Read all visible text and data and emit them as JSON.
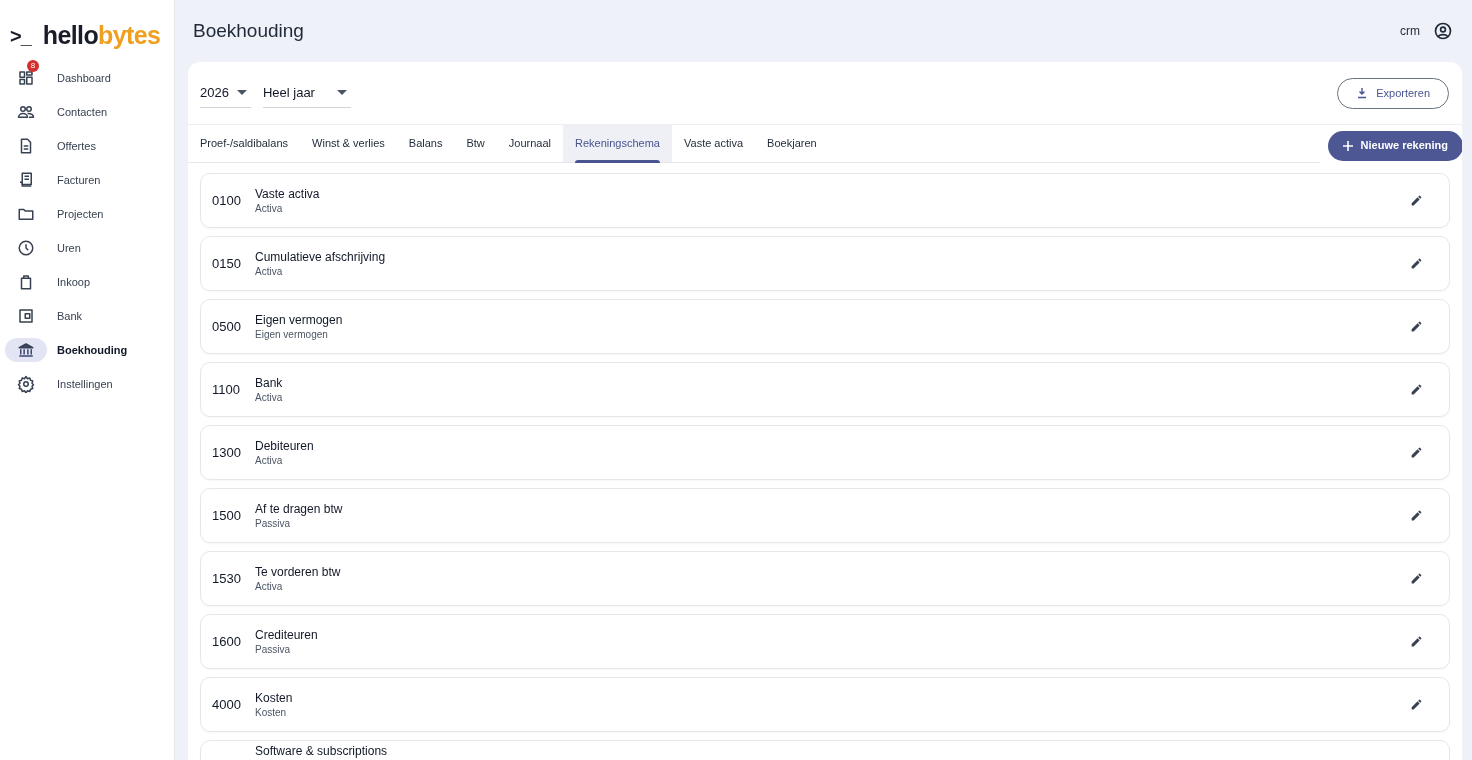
{
  "logo": {
    "prompt": ">_",
    "name_dark": "hello",
    "name_accent": "bytes"
  },
  "sidebar": {
    "items": [
      {
        "label": "Dashboard",
        "selected": false,
        "badge": "8"
      },
      {
        "label": "Contacten",
        "selected": false
      },
      {
        "label": "Offertes",
        "selected": false
      },
      {
        "label": "Facturen",
        "selected": false
      },
      {
        "label": "Projecten",
        "selected": false
      },
      {
        "label": "Uren",
        "selected": false
      },
      {
        "label": "Inkoop",
        "selected": false
      },
      {
        "label": "Bank",
        "selected": false
      },
      {
        "label": "Boekhouding",
        "selected": true
      },
      {
        "label": "Instellingen",
        "selected": false
      }
    ]
  },
  "header": {
    "title": "Boekhouding",
    "user": "crm"
  },
  "filters": {
    "year": "2026",
    "period": "Heel jaar"
  },
  "export_button": "Exporteren",
  "tabs": [
    {
      "label": "Proef-/saldibalans",
      "selected": false
    },
    {
      "label": "Winst & verlies",
      "selected": false
    },
    {
      "label": "Balans",
      "selected": false
    },
    {
      "label": "Btw",
      "selected": false
    },
    {
      "label": "Journaal",
      "selected": false
    },
    {
      "label": "Rekeningschema",
      "selected": true
    },
    {
      "label": "Vaste activa",
      "selected": false
    },
    {
      "label": "Boekjaren",
      "selected": false
    }
  ],
  "new_button": "Nieuwe rekening",
  "accounts": [
    {
      "code": "0100",
      "name": "Vaste activa",
      "type": "Activa"
    },
    {
      "code": "0150",
      "name": "Cumulatieve afschrijving",
      "type": "Activa"
    },
    {
      "code": "0500",
      "name": "Eigen vermogen",
      "type": "Eigen vermogen"
    },
    {
      "code": "1100",
      "name": "Bank",
      "type": "Activa"
    },
    {
      "code": "1300",
      "name": "Debiteuren",
      "type": "Activa"
    },
    {
      "code": "1500",
      "name": "Af te dragen btw",
      "type": "Passiva"
    },
    {
      "code": "1530",
      "name": "Te vorderen btw",
      "type": "Activa"
    },
    {
      "code": "1600",
      "name": "Crediteuren",
      "type": "Passiva"
    },
    {
      "code": "4000",
      "name": "Kosten",
      "type": "Kosten"
    },
    {
      "name": "Software & subscriptions"
    }
  ]
}
